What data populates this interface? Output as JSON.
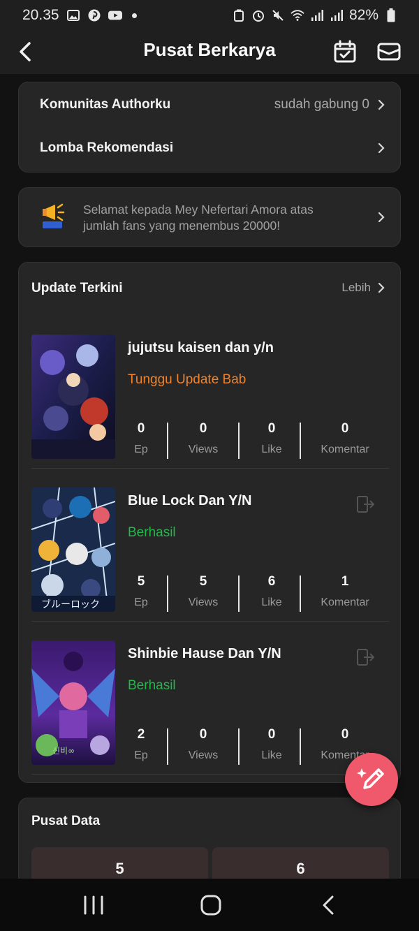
{
  "status_bar": {
    "time": "20.35",
    "battery": "82%"
  },
  "header": {
    "title": "Pusat Berkarya"
  },
  "links": [
    {
      "label": "Komunitas Authorku",
      "value": "sudah gabung 0"
    },
    {
      "label": "Lomba Rekomendasi",
      "value": ""
    }
  ],
  "notice": {
    "text": "Selamat kepada Mey Nefertari Amora atas jumlah fans yang menembus 20000!"
  },
  "updates": {
    "title": "Update Terkini",
    "more": "Lebih",
    "items": [
      {
        "name": "jujutsu kaisen dan y/n",
        "status": "Tunggu Update Bab",
        "status_color": "#f0832a",
        "stats": [
          {
            "num": "0",
            "label": "Ep"
          },
          {
            "num": "0",
            "label": "Views"
          },
          {
            "num": "0",
            "label": "Like"
          },
          {
            "num": "0",
            "label": "Komentar"
          }
        ]
      },
      {
        "name": "Blue Lock Dan Y/N",
        "status": "Berhasil",
        "status_color": "#22b84a",
        "stats": [
          {
            "num": "5",
            "label": "Ep"
          },
          {
            "num": "5",
            "label": "Views"
          },
          {
            "num": "6",
            "label": "Like"
          },
          {
            "num": "1",
            "label": "Komentar"
          }
        ]
      },
      {
        "name": "Shinbie Hause Dan Y/N",
        "status": "Berhasil",
        "status_color": "#22b84a",
        "stats": [
          {
            "num": "2",
            "label": "Ep"
          },
          {
            "num": "0",
            "label": "Views"
          },
          {
            "num": "0",
            "label": "Like"
          },
          {
            "num": "0",
            "label": "Komentar"
          }
        ]
      }
    ]
  },
  "data_center": {
    "title": "Pusat Data",
    "values": [
      "5",
      "6"
    ]
  },
  "colors": {
    "accent": "#f0596b",
    "card": "#262626",
    "background": "#121212"
  },
  "icons": [
    "back-arrow-icon",
    "calendar-check-icon",
    "mail-icon",
    "chevron-right-icon",
    "megaphone-icon",
    "exit-icon",
    "pencil-sparkle-icon",
    "recent-apps-icon",
    "home-icon",
    "nav-back-icon"
  ]
}
